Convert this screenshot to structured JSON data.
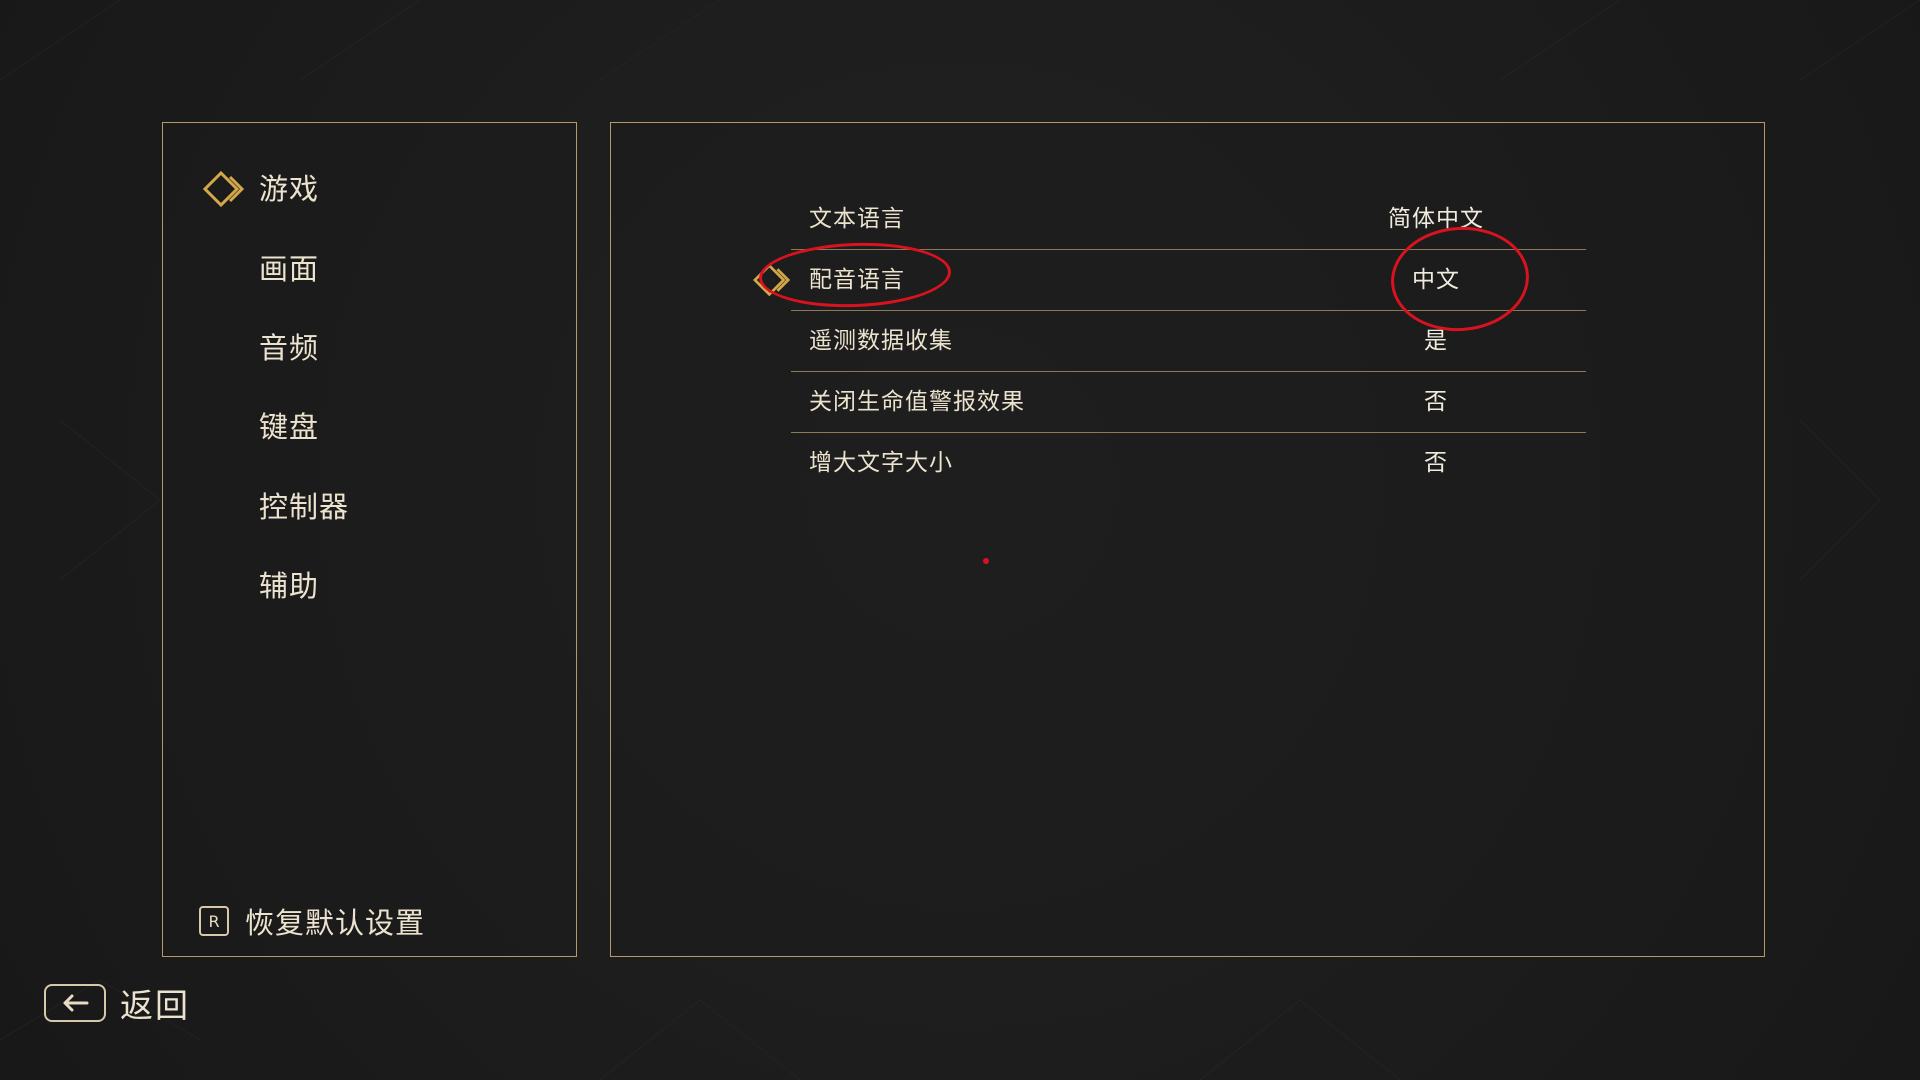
{
  "colors": {
    "accent_gold": "#d4a84a",
    "border_gold": "#b59a66",
    "text": "#ece3cf",
    "annotation_red": "#d8131f",
    "background": "#1d1d1d"
  },
  "sidebar": {
    "selected_index": 0,
    "items": [
      {
        "label": "游戏"
      },
      {
        "label": "画面"
      },
      {
        "label": "音频"
      },
      {
        "label": "键盘"
      },
      {
        "label": "控制器"
      },
      {
        "label": "辅助"
      }
    ],
    "reset": {
      "key": "R",
      "label": "恢复默认设置"
    }
  },
  "settings": {
    "selected_index": 1,
    "rows": [
      {
        "label": "文本语言",
        "value": "简体中文"
      },
      {
        "label": "配音语言",
        "value": "中文"
      },
      {
        "label": "遥测数据收集",
        "value": "是"
      },
      {
        "label": "关闭生命值警报效果",
        "value": "否"
      },
      {
        "label": "增大文字大小",
        "value": "否"
      }
    ]
  },
  "footer": {
    "back_icon": "arrow-left-icon",
    "back_label": "返回"
  },
  "icons": {
    "selector": "diamond-selector-icon",
    "reset_key": "keyboard-r-key-icon"
  }
}
